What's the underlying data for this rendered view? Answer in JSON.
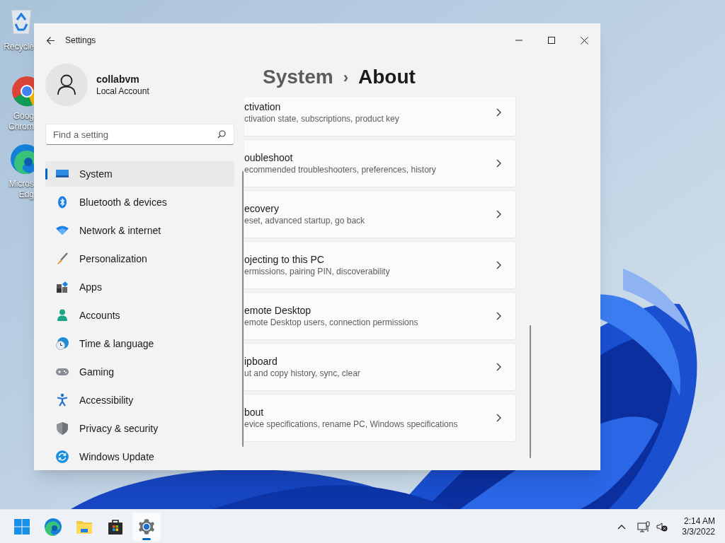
{
  "desktop_icons": [
    {
      "lines": [
        "Recycle"
      ]
    },
    {
      "lines": [
        "Goog",
        "Chrom"
      ]
    },
    {
      "lines": [
        "Micros",
        "Edg"
      ]
    }
  ],
  "window": {
    "title": "Settings"
  },
  "user": {
    "name": "collabvm",
    "account_type": "Local Account"
  },
  "search": {
    "placeholder": "Find a setting"
  },
  "nav": [
    {
      "label": "System",
      "selected": true
    },
    {
      "label": "Bluetooth & devices",
      "selected": false
    },
    {
      "label": "Network & internet",
      "selected": false
    },
    {
      "label": "Personalization",
      "selected": false
    },
    {
      "label": "Apps",
      "selected": false
    },
    {
      "label": "Accounts",
      "selected": false
    },
    {
      "label": "Time & language",
      "selected": false
    },
    {
      "label": "Gaming",
      "selected": false
    },
    {
      "label": "Accessibility",
      "selected": false
    },
    {
      "label": "Privacy & security",
      "selected": false
    },
    {
      "label": "Windows Update",
      "selected": false
    }
  ],
  "breadcrumb": {
    "parent": "System",
    "separator": "›",
    "current": "About"
  },
  "cards": [
    {
      "title": "ctivation",
      "description": "ctivation state, subscriptions, product key"
    },
    {
      "title": "oubleshoot",
      "description": "ecommended troubleshooters, preferences, history"
    },
    {
      "title": "ecovery",
      "description": "eset, advanced startup, go back"
    },
    {
      "title": "ojecting to this PC",
      "description": "ermissions, pairing PIN, discoverability"
    },
    {
      "title": "emote Desktop",
      "description": "emote Desktop users, connection permissions"
    },
    {
      "title": "ipboard",
      "description": "ut and copy history, sync, clear"
    },
    {
      "title": "bout",
      "description": "evice specifications, rename PC, Windows specifications"
    }
  ],
  "taskbar": {
    "apps": [
      {
        "selected": false
      },
      {
        "selected": false
      },
      {
        "selected": false
      },
      {
        "selected": false
      },
      {
        "selected": true
      }
    ],
    "clock": {
      "time": "2:14 AM",
      "date": "3/3/2022"
    }
  }
}
